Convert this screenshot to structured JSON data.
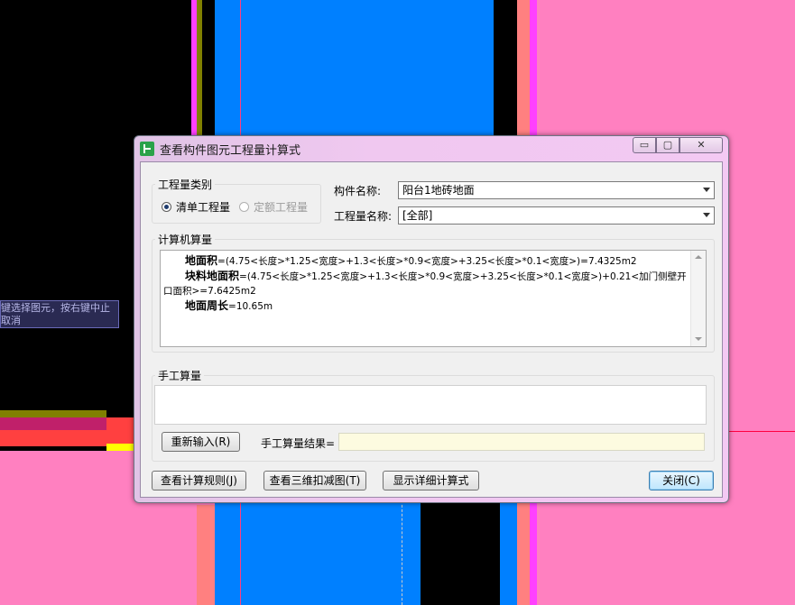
{
  "background_tooltip": {
    "line1": "键选择图元，按右键中止",
    "line2": "取消"
  },
  "dialog": {
    "title": "查看构件图元工程量计算式",
    "window_buttons": {
      "minimize": "▭",
      "maximize": "▢",
      "close": "✕"
    },
    "quantity_type_group": {
      "label": "工程量类别",
      "options": [
        {
          "label": "清单工程量",
          "selected": true
        },
        {
          "label": "定额工程量",
          "selected": false
        }
      ]
    },
    "component_name": {
      "label": "构件名称:",
      "value": "阳台1地砖地面"
    },
    "quantity_name": {
      "label": "工程量名称:",
      "value": "[全部]"
    },
    "computer_calc": {
      "label": "计算机算量",
      "lines": [
        {
          "name": "地面积",
          "formula": "=(4.75<长度>*1.25<宽度>+1.3<长度>*0.9<宽度>+3.25<长度>*0.1<宽度>)=7.4325m2"
        },
        {
          "name": "块料地面积",
          "formula": "=(4.75<长度>*1.25<宽度>+1.3<长度>*0.9<宽度>+3.25<长度>*0.1<宽度>)+0.21<加门侧壁开口面积>=7.6425m2"
        },
        {
          "name": "地面周长",
          "formula": "=10.65m"
        }
      ]
    },
    "manual_calc": {
      "label": "手工算量",
      "reinput_button": "重新输入(R)",
      "result_label": "手工算量结果=",
      "result_value": ""
    },
    "buttons": {
      "view_rules": "查看计算规则(J)",
      "view_3d": "查看三维扣减图(T)",
      "show_detail": "显示详细计算式",
      "close": "关闭(C)"
    }
  },
  "colors": {
    "magenta": "#ff80c0",
    "blue": "#0080ff",
    "salmon": "#ff8080",
    "violet": "#ff40ff",
    "olive": "#808000"
  }
}
